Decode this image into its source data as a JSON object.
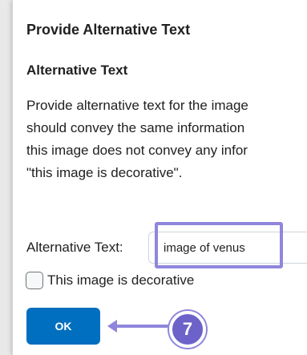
{
  "dialog": {
    "title": "Provide Alternative Text",
    "section_heading": "Alternative Text",
    "instructions_lines": [
      "Provide alternative text for the image",
      "should convey the same information",
      "this image does not convey any infor",
      "\"this image is decorative\"."
    ],
    "alt_text": {
      "label": "Alternative Text:",
      "value": "image of venus"
    },
    "decorative": {
      "label": "This image is decorative",
      "checked": false
    },
    "ok_label": "OK"
  },
  "annotation": {
    "step_number": "7",
    "color": "#8f86dc"
  },
  "colors": {
    "primary_button": "#006fbf",
    "text": "#202122"
  }
}
